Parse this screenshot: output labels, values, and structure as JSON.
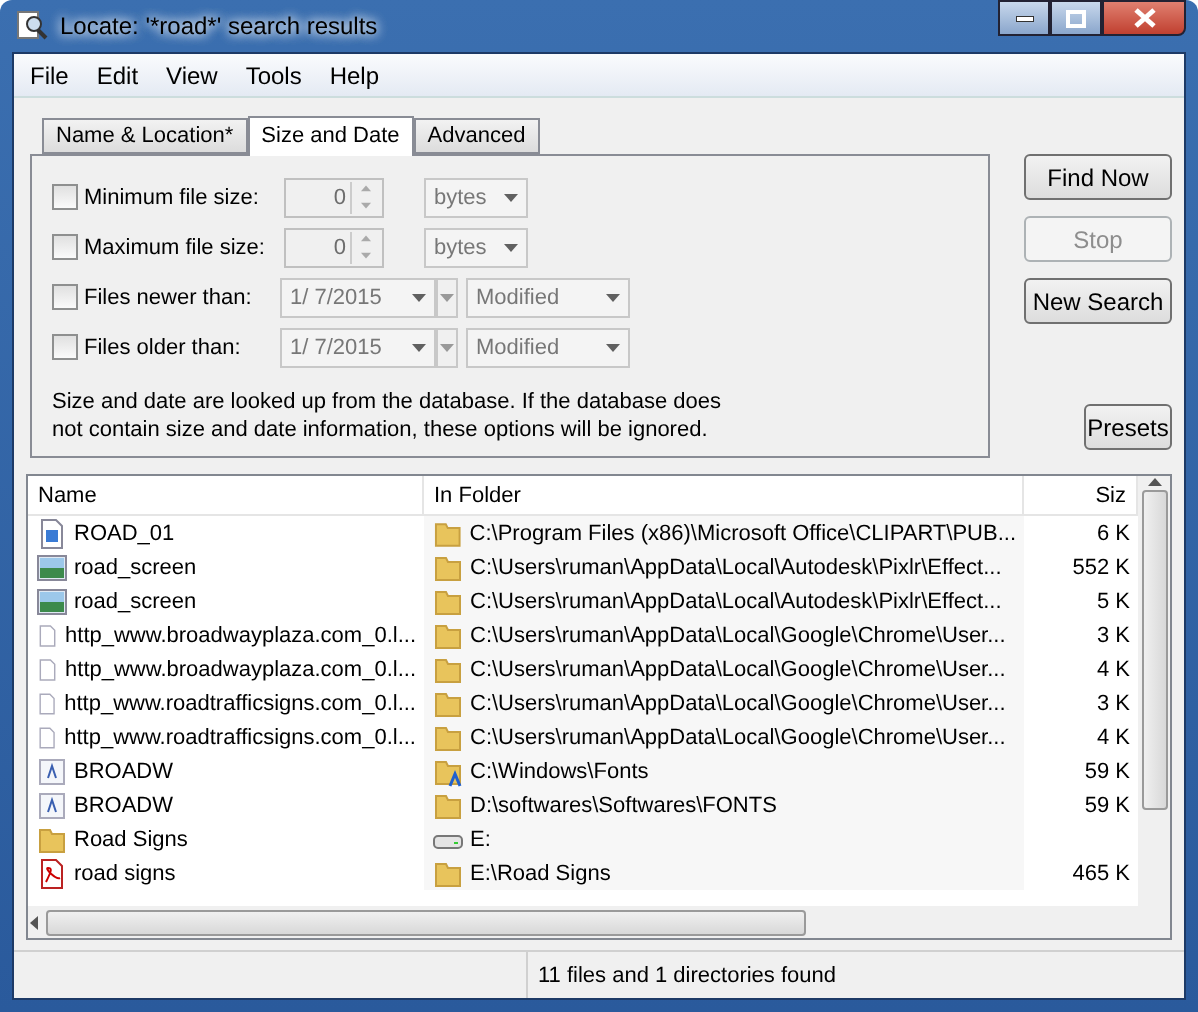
{
  "window": {
    "title": "Locate: '*road*' search results"
  },
  "menu": [
    "File",
    "Edit",
    "View",
    "Tools",
    "Help"
  ],
  "tabs": [
    {
      "label": "Name & Location*",
      "selected": false
    },
    {
      "label": "Size and Date",
      "selected": true
    },
    {
      "label": "Advanced",
      "selected": false
    }
  ],
  "options": [
    {
      "kind": "size",
      "label": "Minimum file size:",
      "checked": false,
      "value": "0",
      "unit": "bytes"
    },
    {
      "kind": "size",
      "label": "Maximum file size:",
      "checked": false,
      "value": "0",
      "unit": "bytes"
    },
    {
      "kind": "date",
      "label": "Files newer than:",
      "checked": false,
      "value": "1/  7/2015",
      "unit": "Modified"
    },
    {
      "kind": "date",
      "label": "Files older than:",
      "checked": false,
      "value": "1/  7/2015",
      "unit": "Modified"
    }
  ],
  "note": "Size and date are looked up from the database. If the database does not contain size and date information, these options will be ignored.",
  "buttons": [
    {
      "label": "Find Now",
      "disabled": false
    },
    {
      "label": "Stop",
      "disabled": true
    },
    {
      "label": "New Search",
      "disabled": false
    }
  ],
  "presets": "Presets",
  "table": {
    "columns": [
      "Name",
      "In Folder",
      "Siz"
    ],
    "rows": [
      {
        "kind": "shortcut",
        "name": "ROAD_01",
        "folder": {
          "kind": "folder",
          "text": "C:\\Program Files (x86)\\Microsoft Office\\CLIPART\\PUB..."
        },
        "size": "6 K"
      },
      {
        "kind": "image",
        "name": "road_screen",
        "folder": {
          "kind": "folder",
          "text": "C:\\Users\\ruman\\AppData\\Local\\Autodesk\\Pixlr\\Effect..."
        },
        "size": "552 K"
      },
      {
        "kind": "image",
        "name": "road_screen",
        "folder": {
          "kind": "folder",
          "text": "C:\\Users\\ruman\\AppData\\Local\\Autodesk\\Pixlr\\Effect..."
        },
        "size": "5 K"
      },
      {
        "kind": "file",
        "name": "http_www.broadwayplaza.com_0.l...",
        "folder": {
          "kind": "folder",
          "text": "C:\\Users\\ruman\\AppData\\Local\\Google\\Chrome\\User..."
        },
        "size": "3 K"
      },
      {
        "kind": "file",
        "name": "http_www.broadwayplaza.com_0.l...",
        "folder": {
          "kind": "folder",
          "text": "C:\\Users\\ruman\\AppData\\Local\\Google\\Chrome\\User..."
        },
        "size": "4 K"
      },
      {
        "kind": "file",
        "name": "http_www.roadtrafficsigns.com_0.l...",
        "folder": {
          "kind": "folder",
          "text": "C:\\Users\\ruman\\AppData\\Local\\Google\\Chrome\\User..."
        },
        "size": "3 K"
      },
      {
        "kind": "file",
        "name": "http_www.roadtrafficsigns.com_0.l...",
        "folder": {
          "kind": "folder",
          "text": "C:\\Users\\ruman\\AppData\\Local\\Google\\Chrome\\User..."
        },
        "size": "4 K"
      },
      {
        "kind": "font",
        "name": "BROADW",
        "folder": {
          "kind": "fontfolder",
          "text": "C:\\Windows\\Fonts"
        },
        "size": "59 K"
      },
      {
        "kind": "font",
        "name": "BROADW",
        "folder": {
          "kind": "folder",
          "text": "D:\\softwares\\Softwares\\FONTS"
        },
        "size": "59 K"
      },
      {
        "kind": "folder",
        "name": "Road Signs",
        "folder": {
          "kind": "drive",
          "text": "E:"
        }
      },
      {
        "kind": "pdf",
        "name": "road signs",
        "folder": {
          "kind": "folder",
          "text": "E:\\Road Signs"
        },
        "size": "465 K"
      }
    ]
  },
  "status_bar": "11 files and 1 directories found"
}
